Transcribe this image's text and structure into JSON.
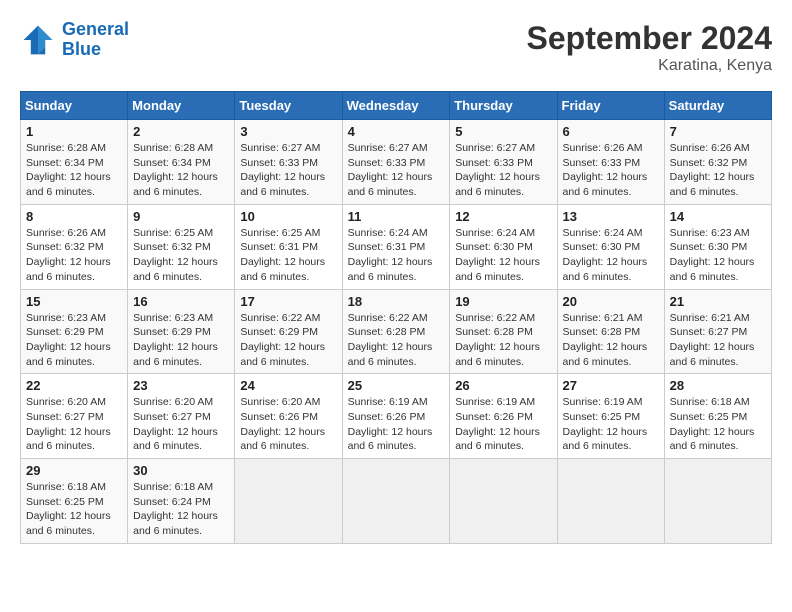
{
  "logo": {
    "line1": "General",
    "line2": "Blue"
  },
  "title": "September 2024",
  "location": "Karatina, Kenya",
  "days_of_week": [
    "Sunday",
    "Monday",
    "Tuesday",
    "Wednesday",
    "Thursday",
    "Friday",
    "Saturday"
  ],
  "weeks": [
    [
      {
        "day": "1",
        "sunrise": "6:28 AM",
        "sunset": "6:34 PM",
        "daylight": "12 hours and 6 minutes."
      },
      {
        "day": "2",
        "sunrise": "6:28 AM",
        "sunset": "6:34 PM",
        "daylight": "12 hours and 6 minutes."
      },
      {
        "day": "3",
        "sunrise": "6:27 AM",
        "sunset": "6:33 PM",
        "daylight": "12 hours and 6 minutes."
      },
      {
        "day": "4",
        "sunrise": "6:27 AM",
        "sunset": "6:33 PM",
        "daylight": "12 hours and 6 minutes."
      },
      {
        "day": "5",
        "sunrise": "6:27 AM",
        "sunset": "6:33 PM",
        "daylight": "12 hours and 6 minutes."
      },
      {
        "day": "6",
        "sunrise": "6:26 AM",
        "sunset": "6:33 PM",
        "daylight": "12 hours and 6 minutes."
      },
      {
        "day": "7",
        "sunrise": "6:26 AM",
        "sunset": "6:32 PM",
        "daylight": "12 hours and 6 minutes."
      }
    ],
    [
      {
        "day": "8",
        "sunrise": "6:26 AM",
        "sunset": "6:32 PM",
        "daylight": "12 hours and 6 minutes."
      },
      {
        "day": "9",
        "sunrise": "6:25 AM",
        "sunset": "6:32 PM",
        "daylight": "12 hours and 6 minutes."
      },
      {
        "day": "10",
        "sunrise": "6:25 AM",
        "sunset": "6:31 PM",
        "daylight": "12 hours and 6 minutes."
      },
      {
        "day": "11",
        "sunrise": "6:24 AM",
        "sunset": "6:31 PM",
        "daylight": "12 hours and 6 minutes."
      },
      {
        "day": "12",
        "sunrise": "6:24 AM",
        "sunset": "6:30 PM",
        "daylight": "12 hours and 6 minutes."
      },
      {
        "day": "13",
        "sunrise": "6:24 AM",
        "sunset": "6:30 PM",
        "daylight": "12 hours and 6 minutes."
      },
      {
        "day": "14",
        "sunrise": "6:23 AM",
        "sunset": "6:30 PM",
        "daylight": "12 hours and 6 minutes."
      }
    ],
    [
      {
        "day": "15",
        "sunrise": "6:23 AM",
        "sunset": "6:29 PM",
        "daylight": "12 hours and 6 minutes."
      },
      {
        "day": "16",
        "sunrise": "6:23 AM",
        "sunset": "6:29 PM",
        "daylight": "12 hours and 6 minutes."
      },
      {
        "day": "17",
        "sunrise": "6:22 AM",
        "sunset": "6:29 PM",
        "daylight": "12 hours and 6 minutes."
      },
      {
        "day": "18",
        "sunrise": "6:22 AM",
        "sunset": "6:28 PM",
        "daylight": "12 hours and 6 minutes."
      },
      {
        "day": "19",
        "sunrise": "6:22 AM",
        "sunset": "6:28 PM",
        "daylight": "12 hours and 6 minutes."
      },
      {
        "day": "20",
        "sunrise": "6:21 AM",
        "sunset": "6:28 PM",
        "daylight": "12 hours and 6 minutes."
      },
      {
        "day": "21",
        "sunrise": "6:21 AM",
        "sunset": "6:27 PM",
        "daylight": "12 hours and 6 minutes."
      }
    ],
    [
      {
        "day": "22",
        "sunrise": "6:20 AM",
        "sunset": "6:27 PM",
        "daylight": "12 hours and 6 minutes."
      },
      {
        "day": "23",
        "sunrise": "6:20 AM",
        "sunset": "6:27 PM",
        "daylight": "12 hours and 6 minutes."
      },
      {
        "day": "24",
        "sunrise": "6:20 AM",
        "sunset": "6:26 PM",
        "daylight": "12 hours and 6 minutes."
      },
      {
        "day": "25",
        "sunrise": "6:19 AM",
        "sunset": "6:26 PM",
        "daylight": "12 hours and 6 minutes."
      },
      {
        "day": "26",
        "sunrise": "6:19 AM",
        "sunset": "6:26 PM",
        "daylight": "12 hours and 6 minutes."
      },
      {
        "day": "27",
        "sunrise": "6:19 AM",
        "sunset": "6:25 PM",
        "daylight": "12 hours and 6 minutes."
      },
      {
        "day": "28",
        "sunrise": "6:18 AM",
        "sunset": "6:25 PM",
        "daylight": "12 hours and 6 minutes."
      }
    ],
    [
      {
        "day": "29",
        "sunrise": "6:18 AM",
        "sunset": "6:25 PM",
        "daylight": "12 hours and 6 minutes."
      },
      {
        "day": "30",
        "sunrise": "6:18 AM",
        "sunset": "6:24 PM",
        "daylight": "12 hours and 6 minutes."
      },
      null,
      null,
      null,
      null,
      null
    ]
  ]
}
